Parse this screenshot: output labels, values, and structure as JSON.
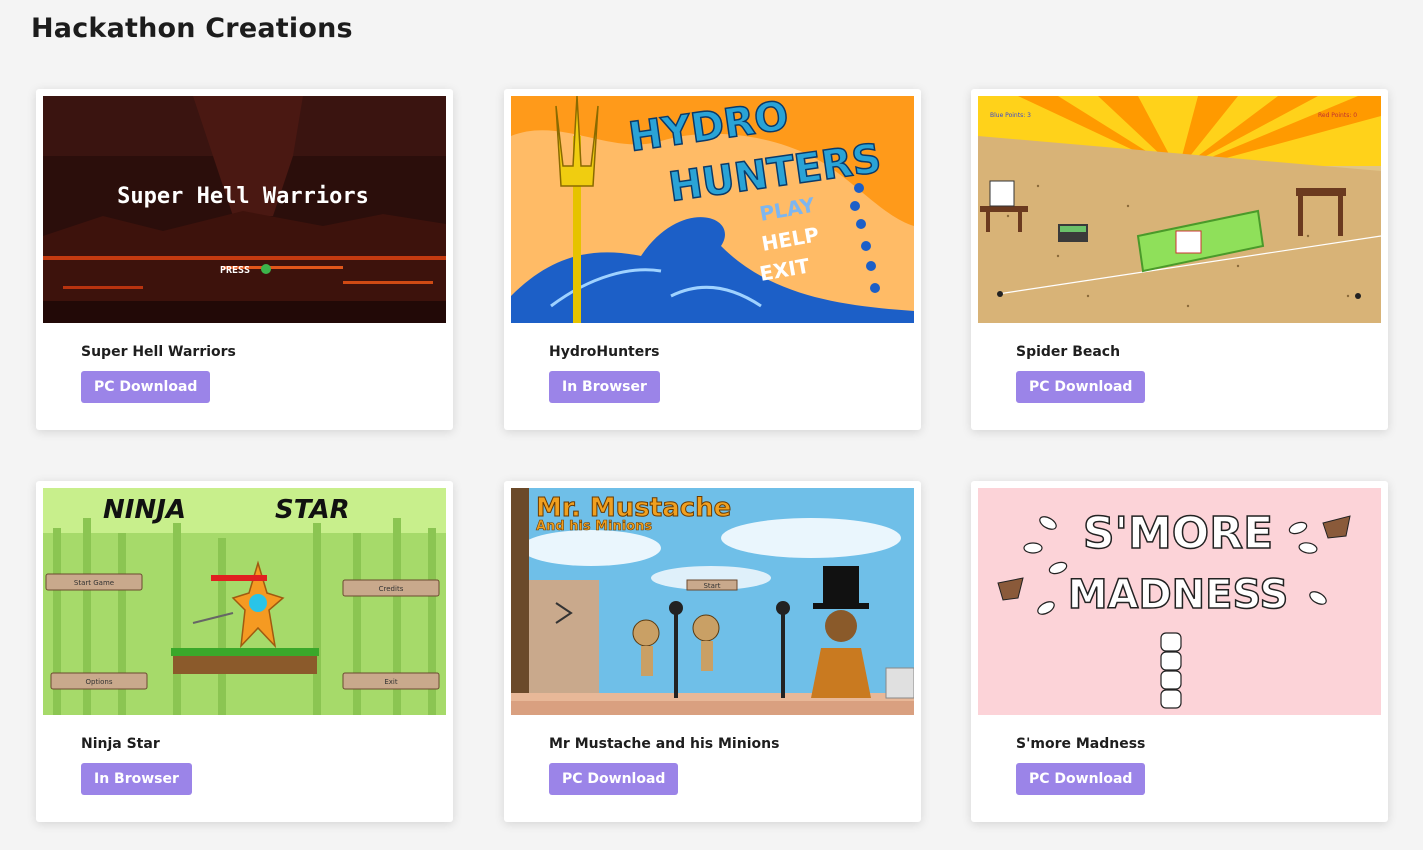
{
  "page": {
    "title": "Hackathon Creations"
  },
  "cards": [
    {
      "title": "Super Hell Warriors",
      "button": "PC Download",
      "image": {
        "title_text": "Super Hell Warriors",
        "prompt": "PRESS",
        "prompt_icon": "a-button-icon"
      }
    },
    {
      "title": "HydroHunters",
      "button": "In Browser",
      "image": {
        "title_line1": "HYDRO",
        "title_line2": "HUNTERS",
        "menu": [
          "PLAY",
          "HELP",
          "EXIT"
        ]
      }
    },
    {
      "title": "Spider Beach",
      "button": "PC Download",
      "image": {
        "blue_points": "Blue Points: 3",
        "red_points": "Red Points: 0"
      }
    },
    {
      "title": "Ninja Star",
      "button": "In Browser",
      "image": {
        "title_left": "NINJA",
        "title_right": "STAR",
        "menu": [
          "Start Game",
          "Credits",
          "Options",
          "Exit"
        ]
      }
    },
    {
      "title": "Mr Mustache and his Minions",
      "button": "PC Download",
      "image": {
        "title_line1": "Mr. Mustache",
        "title_line2": "And his Minions",
        "start": "Start"
      }
    },
    {
      "title": "S'more Madness",
      "button": "PC Download",
      "image": {
        "title_line1": "S'MORE",
        "title_line2": "MADNESS"
      }
    }
  ],
  "colors": {
    "button": "#9b84e8",
    "background": "#f4f4f4"
  }
}
